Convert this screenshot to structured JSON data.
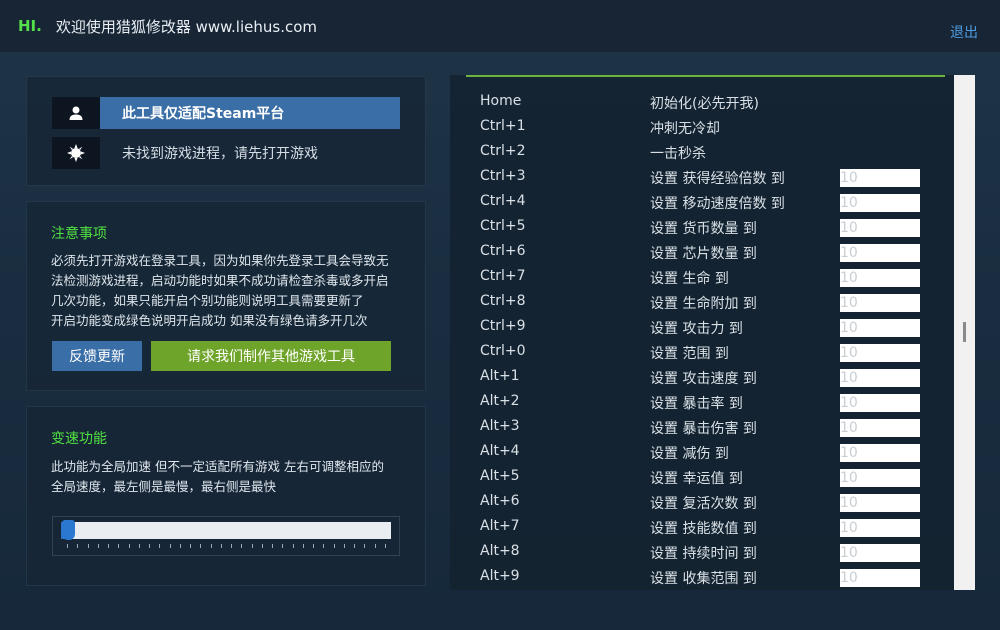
{
  "header": {
    "hi": "HI.",
    "welcome": "欢迎使用猎狐修改器 www.liehus.com",
    "exit_label": "退出"
  },
  "platform": {
    "label": "此工具仅适配Steam平台",
    "status": "未找到游戏进程，请先打开游戏",
    "user_icon": "user-icon",
    "status_icon": "gear-icon"
  },
  "notice": {
    "title": "注意事项",
    "lines": [
      "必须先打开游戏在登录工具，因为如果你先登录工具会导致无",
      "法检测游戏进程，启动功能时如果不成功请检查杀毒或多开启",
      "几次功能，如果只能开启个别功能则说明工具需要更新了",
      "开启功能变成绿色说明开启成功 如果没有绿色请多开几次"
    ],
    "feedback_label": "反馈更新",
    "request_label": "请求我们制作其他游戏工具"
  },
  "speed": {
    "title": "变速功能",
    "lines": [
      "此功能为全局加速 但不一定适配所有游戏 左右可调整相应的",
      "全局速度，最左侧是最慢，最右侧是最快"
    ],
    "value": 0.0,
    "tick_count": 32
  },
  "hotkeys": [
    {
      "key": "Home",
      "desc": "初始化(必先开我)"
    },
    {
      "key": "Ctrl+1",
      "desc": "冲刺无冷却"
    },
    {
      "key": "Ctrl+2",
      "desc": "一击秒杀"
    },
    {
      "key": "Ctrl+3",
      "desc": "设置 获得经验倍数 到",
      "value": "10"
    },
    {
      "key": "Ctrl+4",
      "desc": "设置 移动速度倍数 到",
      "value": "10"
    },
    {
      "key": "Ctrl+5",
      "desc": "设置 货币数量 到",
      "value": "10"
    },
    {
      "key": "Ctrl+6",
      "desc": "设置 芯片数量 到",
      "value": "10"
    },
    {
      "key": "Ctrl+7",
      "desc": "设置 生命 到",
      "value": "10"
    },
    {
      "key": "Ctrl+8",
      "desc": "设置 生命附加 到",
      "value": "10"
    },
    {
      "key": "Ctrl+9",
      "desc": "设置 攻击力 到",
      "value": "10"
    },
    {
      "key": "Ctrl+0",
      "desc": "设置 范围 到",
      "value": "10"
    },
    {
      "key": "Alt+1",
      "desc": "设置 攻击速度 到",
      "value": "10"
    },
    {
      "key": "Alt+2",
      "desc": "设置 暴击率 到",
      "value": "10"
    },
    {
      "key": "Alt+3",
      "desc": "设置 暴击伤害 到",
      "value": "10"
    },
    {
      "key": "Alt+4",
      "desc": "设置 减伤 到",
      "value": "10"
    },
    {
      "key": "Alt+5",
      "desc": "设置 幸运值 到",
      "value": "10"
    },
    {
      "key": "Alt+6",
      "desc": "设置 复活次数 到",
      "value": "10"
    },
    {
      "key": "Alt+7",
      "desc": "设置 技能数值 到",
      "value": "10"
    },
    {
      "key": "Alt+8",
      "desc": "设置 持续时间 到",
      "value": "10"
    },
    {
      "key": "Alt+9",
      "desc": "设置 收集范围 到",
      "value": "10"
    }
  ],
  "colors": {
    "accent_green": "#50e040",
    "accent_blue": "#3a6ea6",
    "button_green": "#6fa42a",
    "line_green": "#6db33f"
  }
}
